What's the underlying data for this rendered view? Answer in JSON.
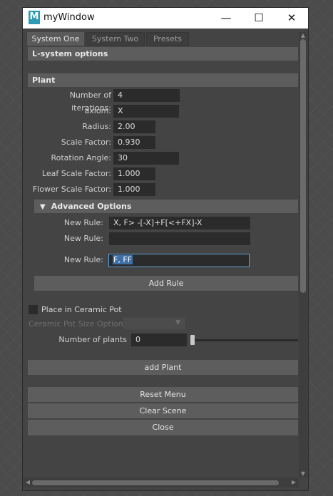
{
  "window": {
    "title": "myWindow",
    "app_icon_letter": "M",
    "minimize": "—",
    "maximize": "☐",
    "close": "✕"
  },
  "tabs": [
    {
      "label": "System One",
      "active": true
    },
    {
      "label": "System Two",
      "active": false
    },
    {
      "label": "Presets",
      "active": false
    }
  ],
  "sections": {
    "lsystem": "L-system options",
    "plant": "Plant",
    "advanced": "Advanced Options"
  },
  "plant_fields": [
    {
      "label": "Number of iterations:",
      "value": "4"
    },
    {
      "label": "axiom:",
      "value": "X"
    },
    {
      "label": "Radius:",
      "value": "2.00"
    },
    {
      "label": "Scale Factor:",
      "value": "0.930"
    },
    {
      "label": "Rotation Angle:",
      "value": "30"
    },
    {
      "label": "Leaf Scale Factor:",
      "value": "1.000"
    },
    {
      "label": "Flower Scale Factor:",
      "value": "1.000"
    }
  ],
  "rules": [
    {
      "label": "New Rule:",
      "value": "X, F> -[-X]+F[<+FX]-X"
    },
    {
      "label": "New Rule:",
      "value": ""
    },
    {
      "label": "New Rule:",
      "value": "F, FF"
    }
  ],
  "buttons": {
    "add_rule": "Add Rule",
    "add_plant": "add Plant",
    "reset_menu": "Reset Menu",
    "clear_scene": "Clear Scene",
    "close": "Close"
  },
  "pot": {
    "checkbox_label": "Place in Ceramic Pot",
    "size_label": "Ceramic Pot Size Options",
    "num_plants_label": "Number of plants",
    "num_plants_value": "0"
  },
  "icons": {
    "collapse": "▼",
    "dropdown": "▼",
    "scroll_up": "▲",
    "scroll_down": "▼",
    "scroll_left": "◀",
    "scroll_right": "▶"
  },
  "colors": {
    "focus_border": "#5fa0d8",
    "selection": "#3e6fa6",
    "panel": "#444444"
  }
}
